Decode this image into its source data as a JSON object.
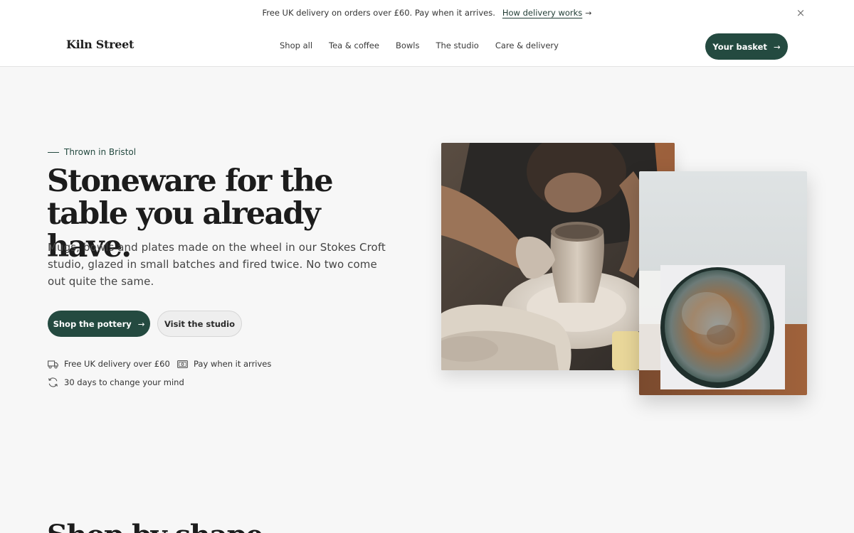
{
  "announcement": {
    "message": "Free UK delivery on orders over £60. Pay when it arrives.",
    "link_label": "How delivery works",
    "link_arrow": "→",
    "close_glyph": "×"
  },
  "header": {
    "logo": "Kiln Street",
    "nav": [
      "Shop all",
      "Tea & coffee",
      "Bowls",
      "The studio",
      "Care & delivery"
    ],
    "basket_label": "Your basket",
    "basket_arrow": "→"
  },
  "hero": {
    "eyebrow": "Thrown in Bristol",
    "headline_line1": "Stoneware for the",
    "headline_line2": "table you already have.",
    "lede": "Mugs, bowls and plates made on the wheel in our Stokes Croft studio, glazed in small batches and fired twice. No two come out quite the same.",
    "primary_cta": "Shop the pottery",
    "primary_arrow": "→",
    "secondary_cta": "Visit the studio",
    "perks": [
      {
        "icon": "truck-icon",
        "label": "Free UK delivery over £60"
      },
      {
        "icon": "cash-icon",
        "label": "Pay when it arrives"
      },
      {
        "icon": "refresh-icon",
        "label": "30 days to change your mind"
      }
    ]
  },
  "next_section": {
    "heading": "Shop by shape"
  },
  "colors": {
    "brand_green": "#244a40",
    "background": "#f7f7f7",
    "header_bg": "#ffffff"
  }
}
